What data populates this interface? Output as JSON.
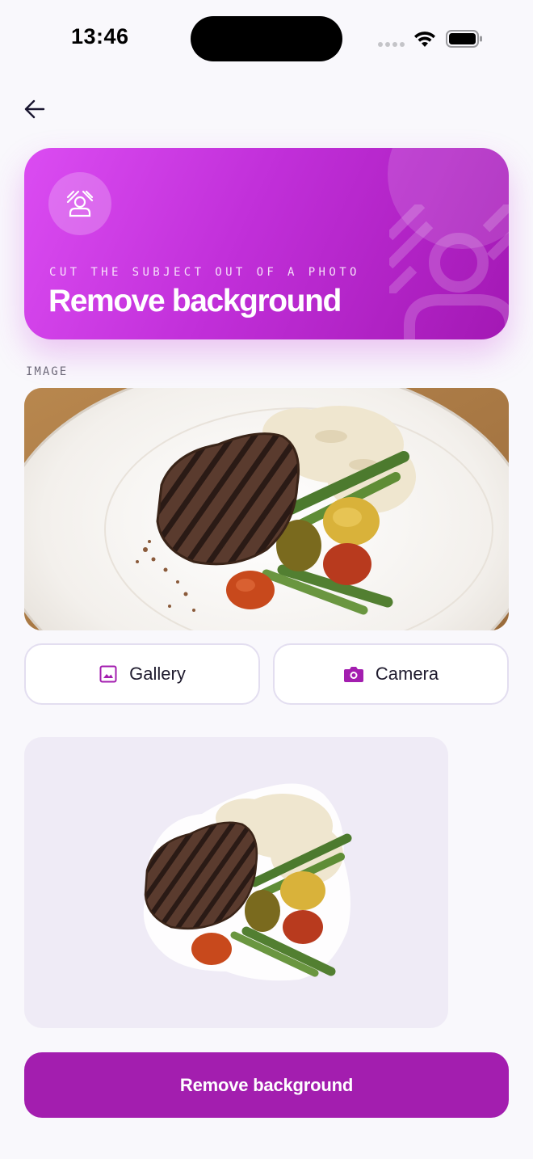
{
  "status_bar": {
    "time": "13:46"
  },
  "nav": {
    "back_icon": "arrow-left-icon"
  },
  "hero": {
    "subtitle": "CUT THE SUBJECT OUT OF A PHOTO",
    "title": "Remove background",
    "icon": "portrait-remove-icon",
    "gradient_start": "#db4cf2",
    "gradient_end": "#a318b4"
  },
  "image_section": {
    "label": "IMAGE",
    "source_image_alt": "steak-with-asparagus-and-mashed-potatoes-photo"
  },
  "buttons": {
    "gallery": {
      "label": "Gallery",
      "icon": "image-icon"
    },
    "camera": {
      "label": "Camera",
      "icon": "camera-icon"
    }
  },
  "result": {
    "image_alt": "cutout-steak-plate-no-background"
  },
  "cta": {
    "label": "Remove background",
    "color": "#a31eaf"
  },
  "accent_color": "#a31eaf"
}
